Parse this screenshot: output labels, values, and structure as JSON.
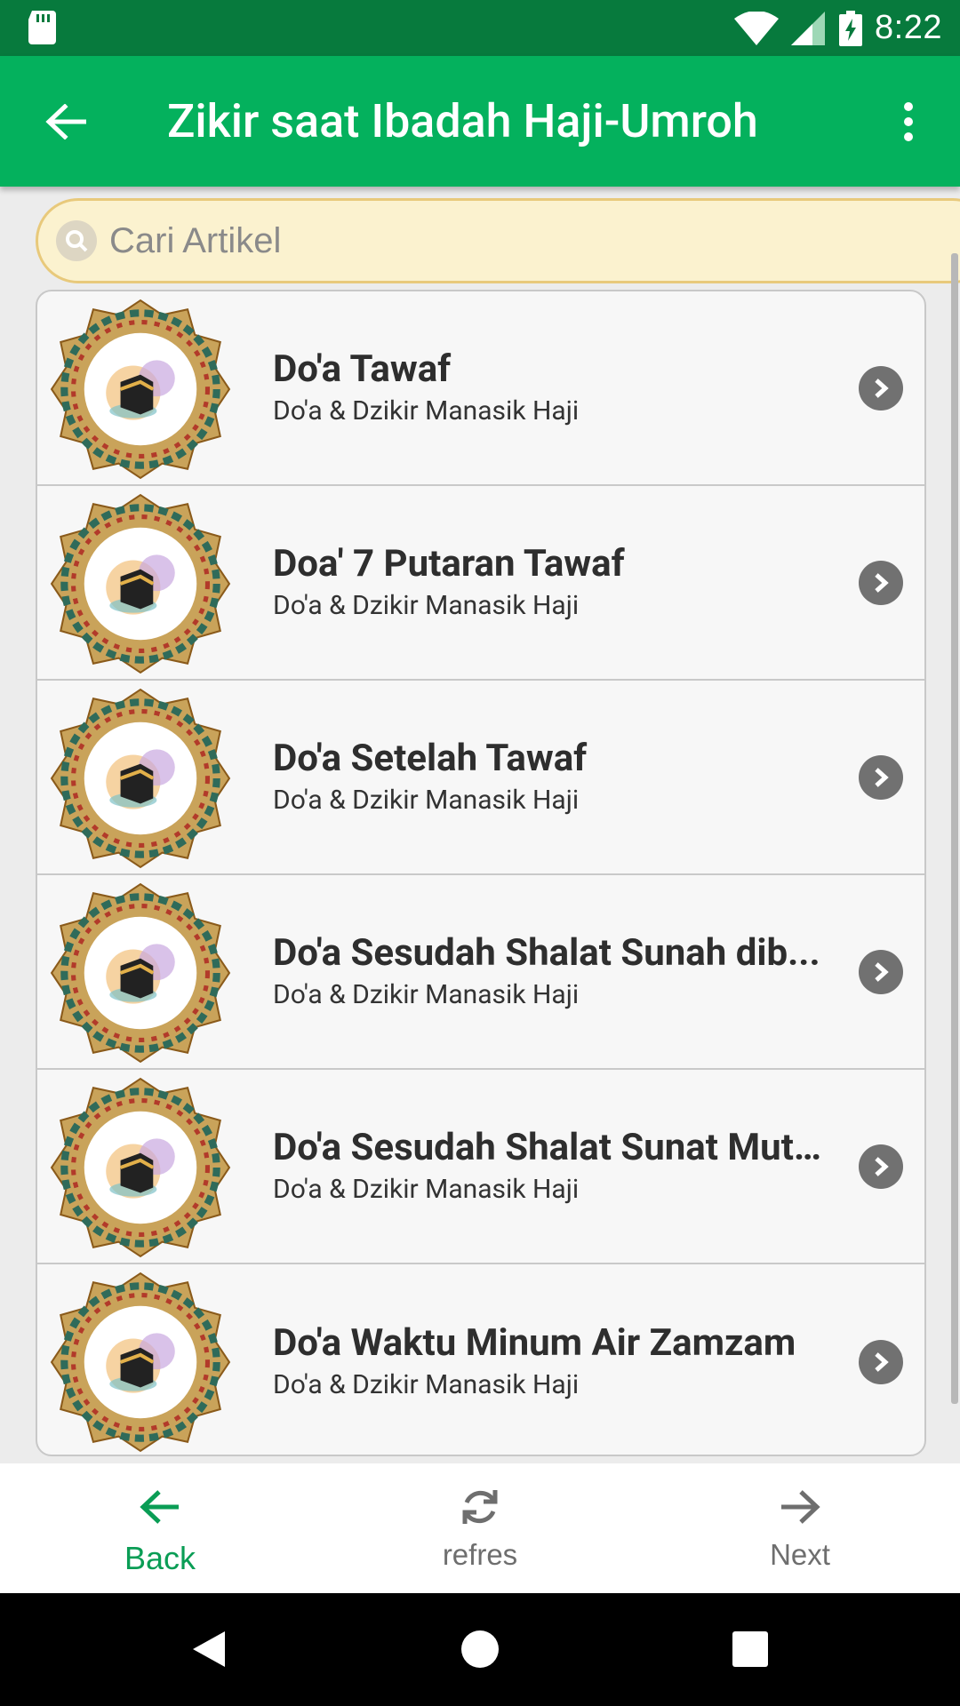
{
  "status_bar": {
    "time": "8:22",
    "icons": [
      "sd-card-icon",
      "wifi-icon",
      "signal-icon",
      "battery-charging-icon"
    ]
  },
  "app_bar": {
    "title": "Zikir saat Ibadah Haji-Umroh",
    "back_icon": "arrow-left-icon",
    "menu_icon": "more-vert-icon"
  },
  "search": {
    "placeholder": "Cari Artikel",
    "value": ""
  },
  "list": {
    "items": [
      {
        "title": "Do'a Tawaf",
        "subtitle": "Do'a & Dzikir Manasik Haji"
      },
      {
        "title": "Doa' 7 Putaran Tawaf",
        "subtitle": "Do'a & Dzikir Manasik Haji"
      },
      {
        "title": "Do'a Setelah Tawaf",
        "subtitle": "Do'a & Dzikir Manasik Haji"
      },
      {
        "title": "Do'a Sesudah Shalat Sunah dib...",
        "subtitle": "Do'a & Dzikir Manasik Haji"
      },
      {
        "title": "Do'a Sesudah Shalat Sunat Mutl...",
        "subtitle": "Do'a & Dzikir Manasik Haji"
      },
      {
        "title": "Do'a Waktu Minum Air Zamzam",
        "subtitle": "Do'a & Dzikir Manasik Haji"
      }
    ]
  },
  "bottom_bar": {
    "back_label": "Back",
    "refresh_label": "refres",
    "next_label": "Next"
  },
  "colors": {
    "status_bar": "#077a3d",
    "app_bar": "#04b15d",
    "accent": "#0a9d55",
    "search_bg": "#fbf2cf",
    "search_border": "#e8c97b"
  }
}
